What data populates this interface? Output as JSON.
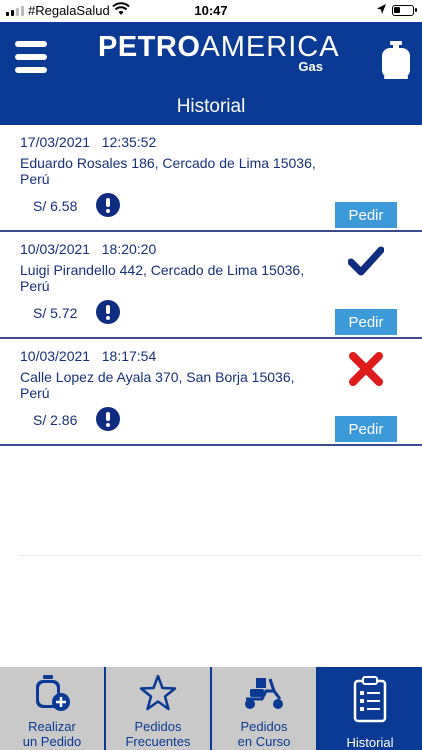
{
  "status_bar": {
    "carrier": "#RegalaSalud",
    "time": "10:47"
  },
  "header": {
    "brand_bold": "PETRO",
    "brand_light": "AMERICA",
    "brand_sub": "Gas",
    "title": "Historial"
  },
  "orders": [
    {
      "date": "17/03/2021",
      "time": "12:35:52",
      "address": "Eduardo Rosales 186, Cercado de Lima 15036, Perú",
      "price": "S/ 6.58",
      "status": "none",
      "action_label": "Pedir"
    },
    {
      "date": "10/03/2021",
      "time": "18:20:20",
      "address": "Luigi Pirandello 442, Cercado de Lima 15036, Perú",
      "price": "S/ 5.72",
      "status": "check",
      "action_label": "Pedir"
    },
    {
      "date": "10/03/2021",
      "time": "18:17:54",
      "address": "Calle Lopez de Ayala 370, San Borja 15036, Perú",
      "price": "S/ 2.86",
      "status": "cross",
      "action_label": "Pedir"
    }
  ],
  "tabs": [
    {
      "line1": "Realizar",
      "line2": "un Pedido",
      "icon": "gas-cylinder-add-icon",
      "active": false
    },
    {
      "line1": "Pedidos",
      "line2": "Frecuentes",
      "icon": "star-icon",
      "active": false
    },
    {
      "line1": "Pedidos",
      "line2": "en Curso",
      "icon": "delivery-scooter-icon",
      "active": false
    },
    {
      "line1": "",
      "line2": "Historial",
      "icon": "clipboard-list-icon",
      "active": true
    }
  ],
  "colors": {
    "primary": "#0a3a94",
    "button": "#3d9ad9",
    "check": "#0f2c80",
    "cross": "#e01b1b",
    "tab_inactive": "#c9c9c9"
  }
}
